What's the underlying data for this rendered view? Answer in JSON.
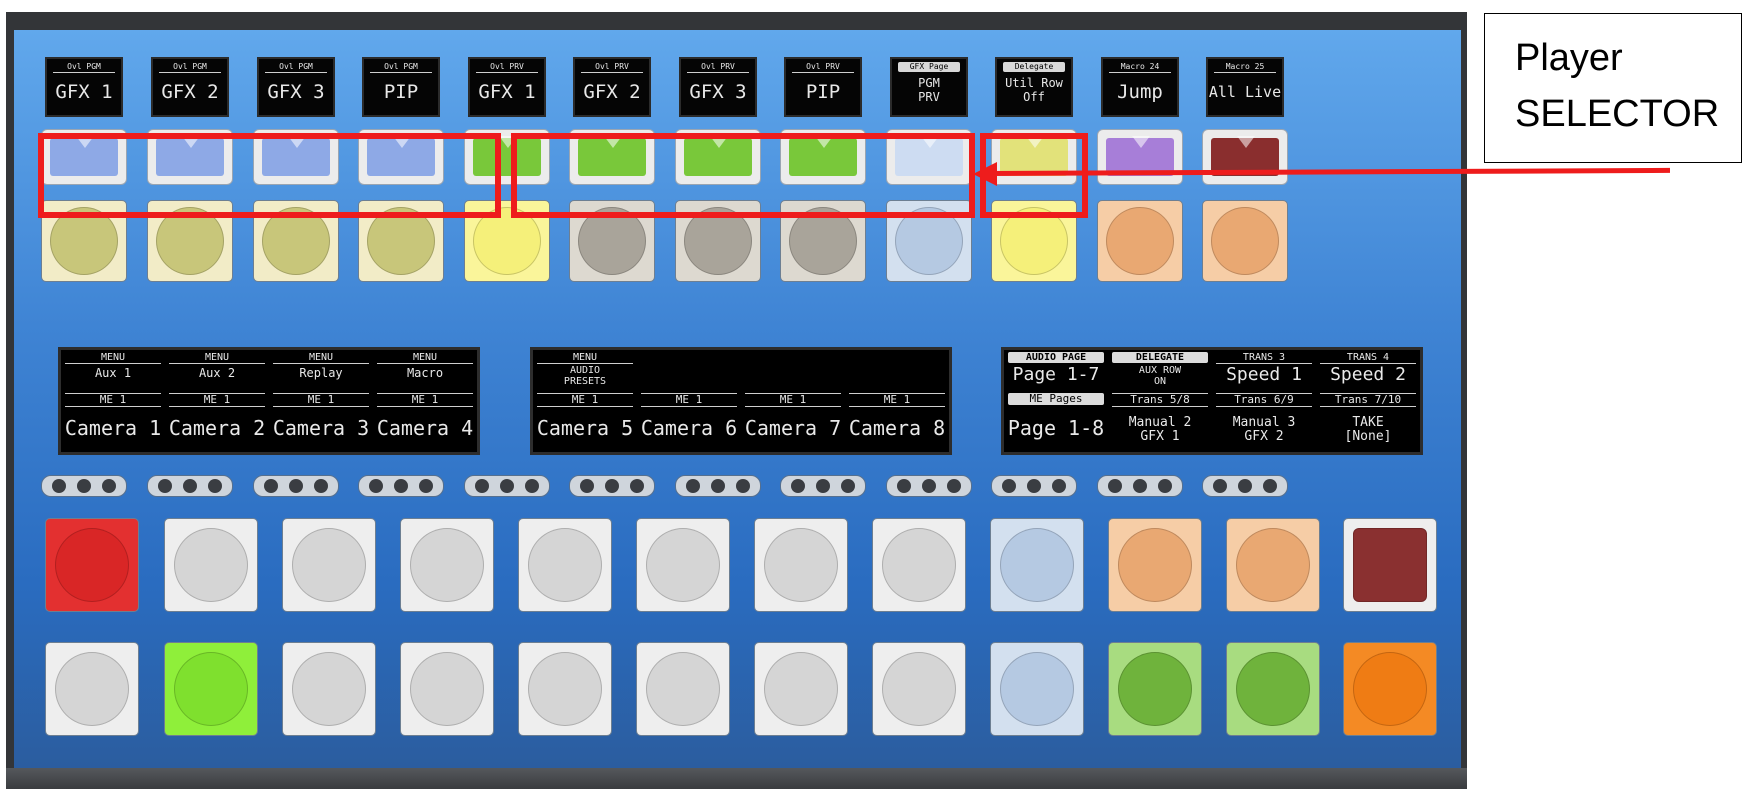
{
  "top_displays": [
    {
      "hdr": "Ovl PGM",
      "big": "GFX 1"
    },
    {
      "hdr": "Ovl PGM",
      "big": "GFX 2"
    },
    {
      "hdr": "Ovl PGM",
      "big": "GFX 3"
    },
    {
      "hdr": "Ovl PGM",
      "big": "PIP"
    },
    {
      "hdr": "Ovl PRV",
      "big": "GFX 1"
    },
    {
      "hdr": "Ovl PRV",
      "big": "GFX 2"
    },
    {
      "hdr": "Ovl PRV",
      "big": "GFX 3"
    },
    {
      "hdr": "Ovl PRV",
      "big": "PIP"
    },
    {
      "hdr": "GFX Page",
      "small": "PGM\nPRV"
    },
    {
      "hdr": "Delegate",
      "small": "Util Row\nOff"
    },
    {
      "hdr": "Macro 24",
      "big": "Jump"
    },
    {
      "hdr": "Macro 25",
      "big": "All Live"
    }
  ],
  "colors": {
    "blue_tally": "#8ea9e6",
    "green_tally": "#79c83a",
    "pale_tally": "#cddcf2",
    "yellow_tally": "#e2e27a",
    "purple_tally": "#a77ed8",
    "maroon_tally": "#8a2e2e",
    "olive_button": "#c8c67a",
    "yellow_button": "#f5f07a",
    "grey_button": "#a9a49a",
    "lightblue_button": "#b5c9e2",
    "orange_button": "#e9a872",
    "red_button": "#e02b2b",
    "light_button": "#d5d5d5",
    "lime_button": "#7fe02e",
    "green_button": "#6fb33c",
    "dark_orange_button": "#ef7c14",
    "dark_red_button": "#8a3030",
    "annotation_red": "#ee1c1c"
  },
  "lcd_left": [
    {
      "menu": "MENU",
      "l2": "Aux 1",
      "l3": "ME 1",
      "bot": "Camera 1"
    },
    {
      "menu": "MENU",
      "l2": "Aux 2",
      "l3": "ME 1",
      "bot": "Camera 2"
    },
    {
      "menu": "MENU",
      "l2": "Replay",
      "l3": "ME 1",
      "bot": "Camera 3"
    },
    {
      "menu": "MENU",
      "l2": "Macro",
      "l3": "ME 1",
      "bot": "Camera 4"
    }
  ],
  "lcd_mid": [
    {
      "menu": "MENU",
      "l2": "AUDIO\nPRESETS",
      "l3": "ME 1",
      "bot": "Camera 5"
    },
    {
      "menu": "",
      "l2": "",
      "l3": "ME 1",
      "bot": "Camera 6"
    },
    {
      "menu": "",
      "l2": "",
      "l3": "ME 1",
      "bot": "Camera 7"
    },
    {
      "menu": "",
      "l2": "",
      "l3": "ME 1",
      "bot": "Camera 8"
    }
  ],
  "lcd_right": [
    {
      "menu": "AUDIO PAGE",
      "l2": "Page 1-7",
      "l3": "ME Pages",
      "bot": "Page 1-8"
    },
    {
      "menu": "DELEGATE",
      "l2": "AUX ROW\nON",
      "l3": "Trans 5/8",
      "bot": "Manual 2\nGFX 1"
    },
    {
      "menu": "TRANS 3",
      "l2": "Speed 1",
      "l3": "Trans 6/9",
      "bot": "Manual 3\nGFX 2"
    },
    {
      "menu": "TRANS 4",
      "l2": "Speed 2",
      "l3": "Trans 7/10",
      "bot": "TAKE\n[None]"
    }
  ],
  "callout": {
    "line1": "Player",
    "line2": "SELECTOR"
  }
}
